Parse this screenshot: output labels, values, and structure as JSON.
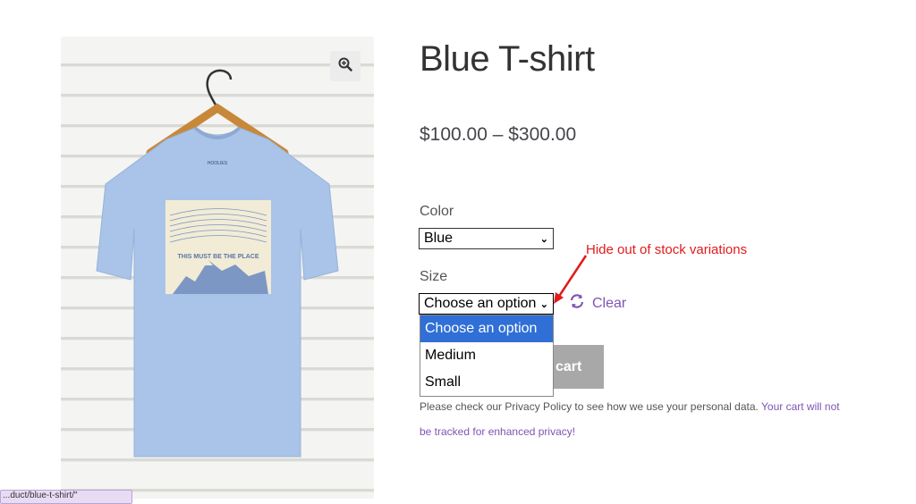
{
  "product": {
    "title": "Blue T-shirt",
    "price": "$100.00 – $300.00",
    "shirt_print_text": "THIS MUST BE THE PLACE",
    "shirt_brand": "HOOLIES"
  },
  "variations": {
    "color_label": "Color",
    "color_value": "Blue",
    "size_label": "Size",
    "size_value": "Choose an option",
    "size_options": [
      "Choose an option",
      "Medium",
      "Small"
    ],
    "clear_label": "Clear"
  },
  "add_to_cart": {
    "label": "cart"
  },
  "privacy": {
    "text": "Please check our Privacy Policy to see how we use your personal data.",
    "link_text": "Your cart will not be tracked for enhanced privacy!"
  },
  "annotation": {
    "text": "Hide out of stock variations",
    "color": "#e01b1b"
  },
  "tooltip": {
    "text": "...duct/blue-t-shirt/\""
  },
  "colors": {
    "accent": "#7f54b3",
    "shirt": "#a9c4e8",
    "select_highlight": "#2f6fd6",
    "disabled_button": "#a8a8a8"
  },
  "icons": {
    "zoom": "zoom-in-icon",
    "clear": "refresh-icon",
    "chevron": "chevron-down-icon"
  }
}
